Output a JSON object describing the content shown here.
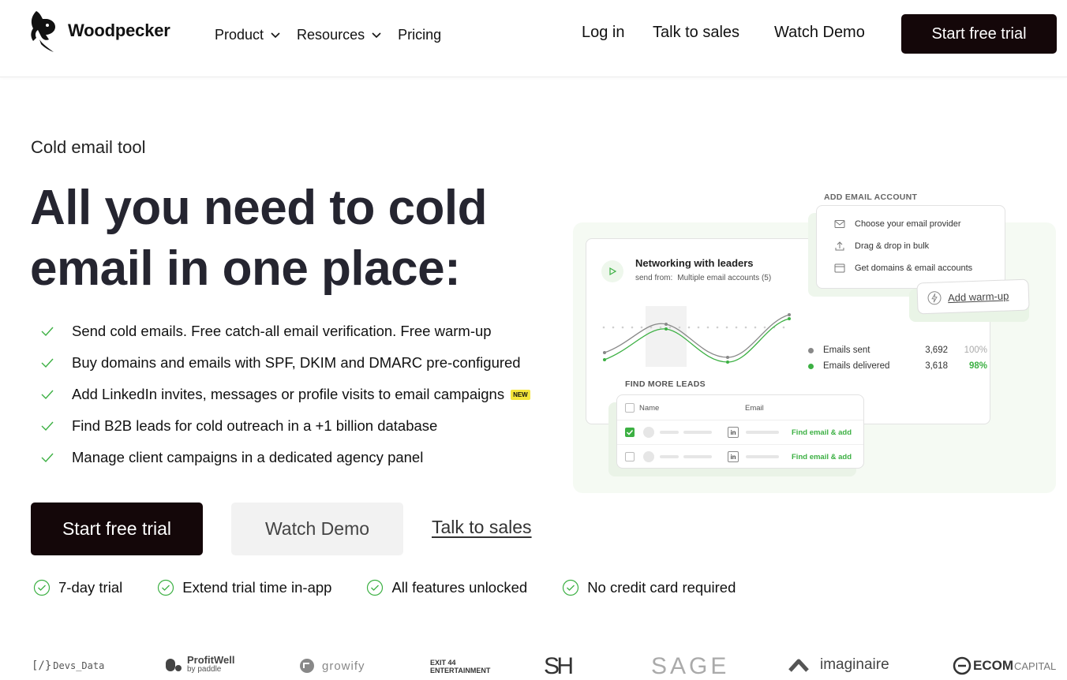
{
  "brand": {
    "name": "Woodpecker"
  },
  "nav": {
    "product": "Product",
    "resources": "Resources",
    "pricing": "Pricing",
    "login": "Log in",
    "talk_to_sales": "Talk to sales",
    "watch_demo": "Watch Demo",
    "start_trial": "Start free trial"
  },
  "hero": {
    "eyebrow": "Cold email tool",
    "headline_line1": "All you need to cold",
    "headline_line2": "email in one place:",
    "features": [
      "Send cold emails. Free catch-all email verification. Free warm-up",
      "Buy domains and emails with SPF, DKIM and DMARC pre-configured",
      "Add LinkedIn invites, messages or profile visits to email campaigns",
      "Find B2B leads for cold outreach in a +1 billion database",
      "Manage client campaigns in a dedicated agency panel"
    ],
    "new_badge": "NEW",
    "cta_primary": "Start free trial",
    "cta_secondary": "Watch Demo",
    "cta_link": "Talk to sales",
    "perks": [
      "7-day trial",
      "Extend trial time in-app",
      "All features unlocked",
      "No credit card required"
    ]
  },
  "illustration": {
    "add_email_title": "ADD EMAIL ACCOUNT",
    "add_email_items": [
      "Choose your email provider",
      "Drag & drop in bulk",
      "Get domains & email accounts"
    ],
    "warmup": "Add warm-up",
    "campaign_title": "Networking with leaders",
    "send_from_label": "send from:",
    "send_from_value": "Multiple email accounts (5)",
    "stats": [
      {
        "label": "Emails sent",
        "value": "3,692",
        "pct": "100%"
      },
      {
        "label": "Emails delivered",
        "value": "3,618",
        "pct": "98%"
      }
    ],
    "leads_title": "FIND MORE LEADS",
    "leads_col_name": "Name",
    "leads_col_email": "Email",
    "leads_action": "Find email & add",
    "linkedin_glyph": "in"
  },
  "logos": {
    "devs_data": "Devs_Data",
    "profitwell": "ProfitWell",
    "profitwell_sub": "by paddle",
    "growify": "growify",
    "exit44_line1": "EXIT 44",
    "exit44_line2": "ENTERTAINMENT",
    "sh": "S H",
    "sage": "SAGE",
    "imaginaire": "imaginaire",
    "ecom_bold": "ECOM",
    "ecom_light": "CAPITAL"
  },
  "colors": {
    "dark": "#140709",
    "accent_green": "#3cb043",
    "illus_bg": "#f5faf3"
  }
}
